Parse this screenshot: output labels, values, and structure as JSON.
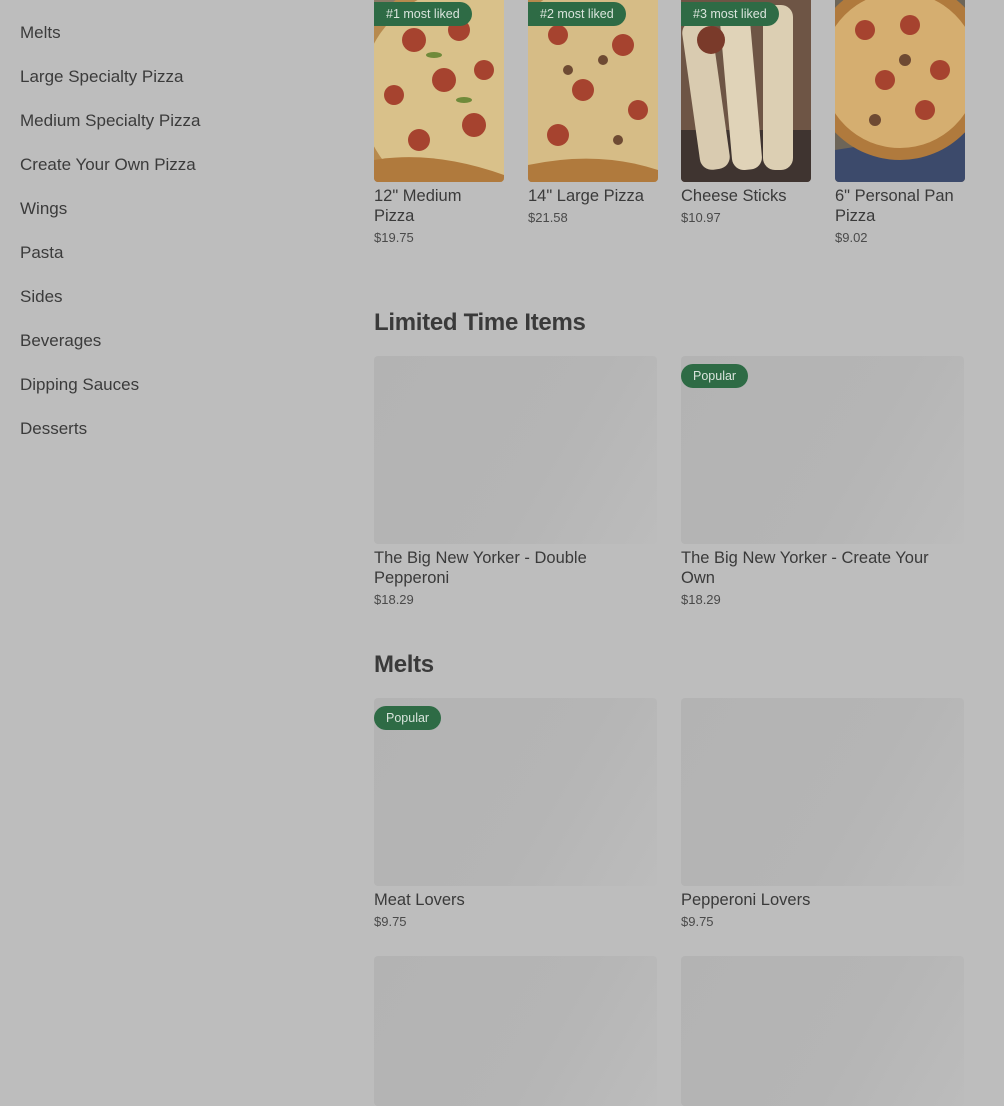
{
  "sidebar": {
    "items": [
      {
        "label": "Melts"
      },
      {
        "label": "Large Specialty Pizza"
      },
      {
        "label": "Medium Specialty Pizza"
      },
      {
        "label": "Create Your Own Pizza"
      },
      {
        "label": "Wings"
      },
      {
        "label": "Pasta"
      },
      {
        "label": "Sides"
      },
      {
        "label": "Beverages"
      },
      {
        "label": "Dipping Sauces"
      },
      {
        "label": "Desserts"
      }
    ]
  },
  "popular": {
    "items": [
      {
        "badge": "#1 most liked",
        "name": "12\" Medium Pizza",
        "price": "$19.75"
      },
      {
        "badge": "#2 most liked",
        "name": "14\" Large Pizza",
        "price": "$21.58"
      },
      {
        "badge": "#3 most liked",
        "name": "Cheese Sticks",
        "price": "$10.97"
      },
      {
        "name": "6\" Personal Pan Pizza",
        "price": "$9.02"
      }
    ]
  },
  "limited": {
    "title": "Limited Time Items",
    "items": [
      {
        "name": "The Big New Yorker - Double Pepperoni",
        "price": "$18.29"
      },
      {
        "badge": "Popular",
        "name": "The Big New Yorker - Create Your Own",
        "price": "$18.29"
      }
    ]
  },
  "melts": {
    "title": "Melts",
    "items": [
      {
        "badge": "Popular",
        "name": "Meat Lovers",
        "price": "$9.75"
      },
      {
        "name": "Pepperoni Lovers",
        "price": "$9.75"
      }
    ]
  },
  "colors": {
    "background": "#bdbdbd",
    "badge": "#2e6b45",
    "text": "#3a3a3a"
  }
}
